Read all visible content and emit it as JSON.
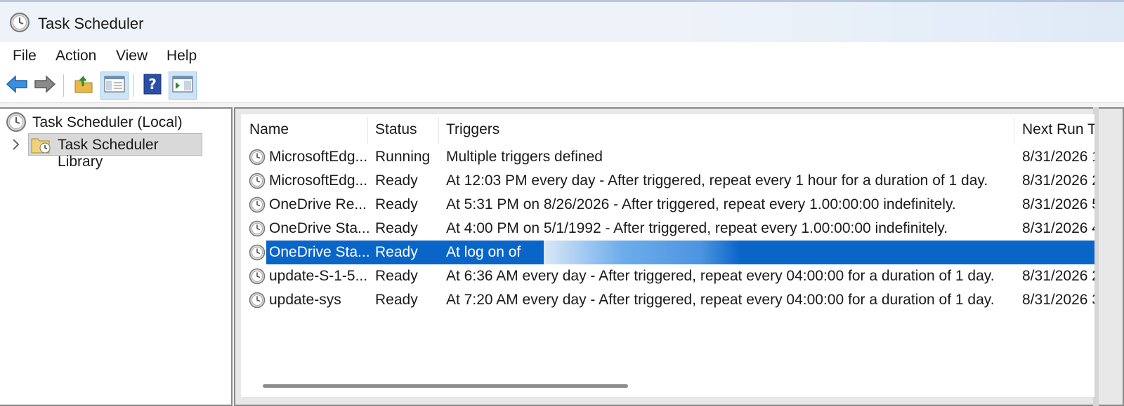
{
  "window": {
    "title": "Task Scheduler"
  },
  "menu": [
    "File",
    "Action",
    "View",
    "Help"
  ],
  "toolbar": {
    "buttons": [
      "back-arrow-icon",
      "forward-arrow-icon",
      "up-folder-icon",
      "show-hide-console-tree-icon",
      "help-icon",
      "show-hide-action-pane-icon"
    ]
  },
  "tree": {
    "root": "Task Scheduler (Local)",
    "library": "Task Scheduler Library"
  },
  "table": {
    "columns": [
      "Name",
      "Status",
      "Triggers",
      "Next Run T"
    ],
    "rows": [
      {
        "name": "MicrosoftEdg...",
        "status": "Running",
        "triggers": "Multiple triggers defined",
        "next_run": "8/31/2026 1"
      },
      {
        "name": "MicrosoftEdg...",
        "status": "Ready",
        "triggers": "At 12:03 PM every day - After triggered, repeat every 1 hour for a duration of 1 day.",
        "next_run": "8/31/2026 2"
      },
      {
        "name": "OneDrive Re...",
        "status": "Ready",
        "triggers": "At 5:31 PM on 8/26/2026 - After triggered, repeat every 1.00:00:00 indefinitely.",
        "next_run": "8/31/2026 5"
      },
      {
        "name": "OneDrive Sta...",
        "status": "Ready",
        "triggers": "At 4:00 PM on 5/1/1992 - After triggered, repeat every 1.00:00:00 indefinitely.",
        "next_run": "8/31/2026 4"
      },
      {
        "name": "OneDrive Sta...",
        "status": "Ready",
        "triggers": "At log on of",
        "next_run": "",
        "selected": true
      },
      {
        "name": "update-S-1-5...",
        "status": "Ready",
        "triggers": "At 6:36 AM every day - After triggered, repeat every 04:00:00 for a duration of 1 day.",
        "next_run": "8/31/2026 2"
      },
      {
        "name": "update-sys",
        "status": "Ready",
        "triggers": "At 7:20 AM every day - After triggered, repeat every 04:00:00 for a duration of 1 day.",
        "next_run": "8/31/2026 3"
      }
    ]
  },
  "colors": {
    "selection": "#0a65c8",
    "toolbar_active": "#cce4f7"
  }
}
